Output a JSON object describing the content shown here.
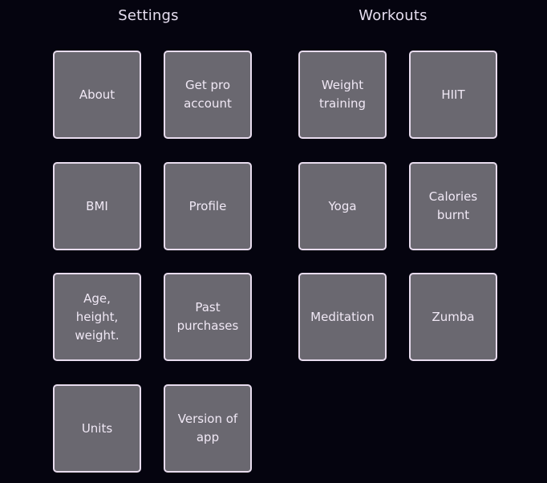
{
  "settings": {
    "title": "Settings",
    "tiles": [
      {
        "label": "About"
      },
      {
        "label": "Get pro\naccount"
      },
      {
        "label": "BMI"
      },
      {
        "label": "Profile"
      },
      {
        "label": "Age,\nheight,\nweight."
      },
      {
        "label": "Past\npurchases"
      },
      {
        "label": "Units"
      },
      {
        "label": "Version of\napp"
      }
    ]
  },
  "workouts": {
    "title": "Workouts",
    "tiles": [
      {
        "label": "Weight\ntraining"
      },
      {
        "label": "HIIT"
      },
      {
        "label": "Yoga"
      },
      {
        "label": "Calories\nburnt"
      },
      {
        "label": "Meditation"
      },
      {
        "label": "Zumba"
      }
    ]
  },
  "colors": {
    "background": "#05040f",
    "tile_fill": "#6a6870",
    "tile_border": "#e8dcee",
    "text": "#f0e8f5"
  }
}
